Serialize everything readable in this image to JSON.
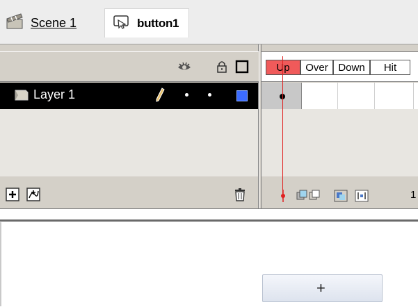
{
  "breadcrumb": {
    "scene_label": "Scene 1",
    "scene_icon": "clapperboard-icon",
    "symbol_label": "button1",
    "symbol_icon": "button-symbol-icon"
  },
  "layers": {
    "header_icons": [
      "eye-icon",
      "lock-icon",
      "outline-square-icon"
    ],
    "items": [
      {
        "name": "Layer 1",
        "active": true,
        "outline_color": "#3c6cff"
      }
    ],
    "footer_icons": [
      "insert-layer-icon",
      "add-motion-guide-icon",
      "trash-icon"
    ]
  },
  "frames": {
    "labels": [
      "Up",
      "Over",
      "Down",
      "Hit"
    ],
    "current": "Up",
    "footer_icons": [
      "center-frame-icon",
      "onion-skin-icon",
      "onion-outlines-icon",
      "edit-multiple-icon",
      "modify-markers-icon"
    ],
    "frame_number": "1"
  },
  "stage": {
    "registration_mark": "+"
  }
}
